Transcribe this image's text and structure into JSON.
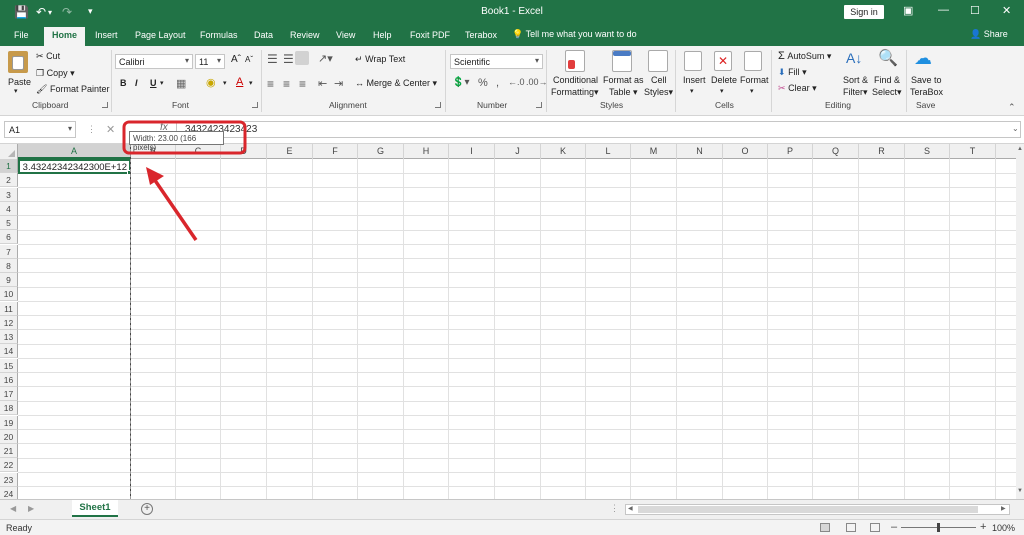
{
  "titlebar": {
    "title": "Book1  -  Excel",
    "signin": "Sign in"
  },
  "tabs": [
    "File",
    "Home",
    "Insert",
    "Page Layout",
    "Formulas",
    "Data",
    "Review",
    "View",
    "Help",
    "Foxit PDF",
    "Terabox"
  ],
  "tellme": "Tell me what you want to do",
  "share": "Share",
  "ribbon": {
    "clipboard": {
      "label": "Clipboard",
      "paste": "Paste",
      "cut": "Cut",
      "copy": "Copy",
      "format_painter": "Format Painter"
    },
    "font": {
      "label": "Font",
      "name": "Calibri",
      "size": "11"
    },
    "alignment": {
      "label": "Alignment",
      "wrap_text": "Wrap Text",
      "merge_center": "Merge & Center"
    },
    "number": {
      "label": "Number",
      "format": "Scientific"
    },
    "styles": {
      "label": "Styles",
      "conditional1": "Conditional",
      "conditional2": "Formatting",
      "format_as1": "Format as",
      "format_as2": "Table",
      "cell1": "Cell",
      "cell2": "Styles"
    },
    "cells": {
      "label": "Cells",
      "insert": "Insert",
      "delete": "Delete",
      "format": "Format"
    },
    "editing": {
      "label": "Editing",
      "autosum": "AutoSum",
      "fill": "Fill",
      "clear": "Clear",
      "sort1": "Sort &",
      "sort2": "Filter",
      "find1": "Find &",
      "find2": "Select"
    },
    "save": {
      "label": "Save",
      "save1": "Save to",
      "save2": "TeraBox"
    }
  },
  "namebox": "A1",
  "formula": "3432423423423",
  "tooltip": "Width: 23.00 (166 pixels)",
  "columns": [
    "A",
    "B",
    "C",
    "D",
    "E",
    "F",
    "G",
    "H",
    "I",
    "J",
    "K",
    "L",
    "M",
    "N",
    "O",
    "P",
    "Q",
    "R",
    "S",
    "T"
  ],
  "rows": [
    "1",
    "2",
    "3",
    "4",
    "5",
    "6",
    "7",
    "8",
    "9",
    "10",
    "11",
    "12",
    "13",
    "14",
    "15",
    "16",
    "17",
    "18",
    "19",
    "20",
    "21",
    "22",
    "23",
    "24"
  ],
  "cells": {
    "A1": "3.43242342342300E+12"
  },
  "sheet": "Sheet1",
  "status": {
    "ready": "Ready",
    "zoom": "100%"
  },
  "colors": {
    "accent": "#217346",
    "annotation": "#d9262c"
  }
}
